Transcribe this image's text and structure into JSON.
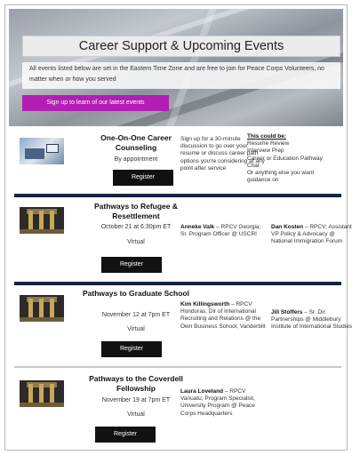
{
  "hero": {
    "title": "Career Support & Upcoming Events",
    "description": "All events listed below are set in the Eastern Time Zone and are free to join for Peace Corps Volunteers, no matter when or how you served",
    "signup_label": "Sign up to learn of our latest events"
  },
  "events": [
    {
      "title": "One-On-One Career Counseling",
      "date": "By appointment",
      "mode": "",
      "register_label": "Register",
      "details": "Sign up for a 30-minute discussion to go over your resume or discuss career path options you're considering at any point after service",
      "could_be_title": "This could be:",
      "could_be_items": [
        "Resume Review",
        "Interview Prep",
        "Career or Education Pathway Chat",
        "Or anything else you want guidance on"
      ]
    },
    {
      "title": "Pathways to Refugee & Resettlement",
      "date": "October 21 at 6:30pm ET",
      "mode": "Virtual",
      "register_label": "Register",
      "speaker1_name": "Anneke Valk",
      "speaker1_info": " – RPCV Georgia; Sr. Program Officer @ USCRI",
      "speaker2_name": "Dan Kosten",
      "speaker2_info": " – RPCV; Assistant VP Policy & Advocacy @ National Immigration Forum"
    },
    {
      "title": "Pathways to Graduate School",
      "date": "November 12 at 7pm ET",
      "mode": "Virtual",
      "register_label": "Register",
      "speaker1_name": "Kim Killingsworth",
      "speaker1_info": " – RPCV Honduras; Dir of International Recruiting and Relations @ the Own Business School, Vanderbilt",
      "speaker2_name": "Jill Stoffers",
      "speaker2_info": " – Sr. Dir. Partnerships @ Middlebury Institute of International Studies"
    },
    {
      "title": "Pathways to the Coverdell Fellowship",
      "date": "November 19 at 7pm ET",
      "mode": "Virtual",
      "register_label": "Register",
      "speaker1_name": "Laura Loveland",
      "speaker1_info": " – RPCV Vanuatu; Program Specialist, University Program @ Peace Corps Headquarters"
    }
  ],
  "colors": {
    "signup_button": "#b21eb4",
    "register_button": "#111111",
    "divider": "#1c2c49"
  },
  "icons": [
    "office-thumbnail",
    "hall-thumbnail"
  ]
}
